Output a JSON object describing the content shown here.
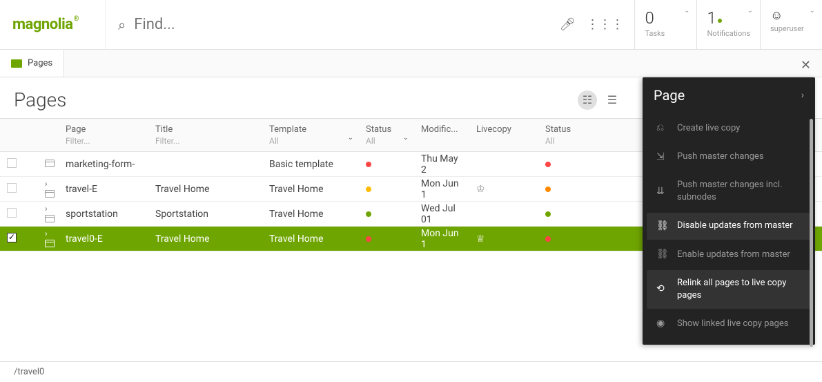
{
  "logo": "magnolia",
  "search": {
    "placeholder": "Find..."
  },
  "topCells": {
    "tasks": {
      "num": "0",
      "label": "Tasks"
    },
    "notifications": {
      "num": "1",
      "label": "Notifications"
    },
    "user": {
      "label": "superuser"
    }
  },
  "tab": {
    "label": "Pages"
  },
  "title": "Pages",
  "headers": {
    "page": {
      "label": "Page",
      "filter": "Filter..."
    },
    "title": {
      "label": "Title",
      "filter": "Filter..."
    },
    "template": {
      "label": "Template",
      "value": "All"
    },
    "status1": {
      "label": "Status",
      "value": "All"
    },
    "modified": {
      "label": "Modific..."
    },
    "livecopy": {
      "label": "Livecopy"
    },
    "status2": {
      "label": "Status",
      "value": "All"
    }
  },
  "rows": [
    {
      "checked": false,
      "expand": "",
      "page": "marketing-form-",
      "title": "",
      "template": "Basic template",
      "s1": "r",
      "mod": "Thu May 2",
      "lc": "",
      "s2": "r"
    },
    {
      "checked": false,
      "expand": "›",
      "page": "travel-E",
      "title": "Travel Home",
      "template": "Travel Home",
      "s1": "y",
      "mod": "Mon Jun 1",
      "lc": "♔",
      "s2": "o"
    },
    {
      "checked": false,
      "expand": "›",
      "page": "sportstation",
      "title": "Sportstation",
      "template": "Travel Home",
      "s1": "g",
      "mod": "Wed Jul 01",
      "lc": "",
      "s2": "g"
    },
    {
      "checked": true,
      "expand": "›",
      "page": "travel0-E",
      "title": "Travel Home",
      "template": "Travel Home",
      "s1": "r",
      "mod": "Mon Jun 1",
      "lc": "♕",
      "s2": "r"
    }
  ],
  "panel": {
    "title": "Page",
    "actions": [
      {
        "icon": "⎌",
        "label": "Create live copy",
        "enabled": false
      },
      {
        "icon": "⇲",
        "label": "Push master changes",
        "enabled": false
      },
      {
        "icon": "⇊",
        "label": "Push master changes incl. subnodes",
        "enabled": false
      },
      {
        "icon": "⛓",
        "label": "Disable updates from master",
        "enabled": true
      },
      {
        "icon": "⛓",
        "label": "Enable updates from master",
        "enabled": false
      },
      {
        "icon": "⟲",
        "label": "Relink all pages to live copy pages",
        "enabled": true
      },
      {
        "icon": "◉",
        "label": "Show linked live copy pages",
        "enabled": false
      }
    ]
  },
  "statusbar": "/travel0"
}
